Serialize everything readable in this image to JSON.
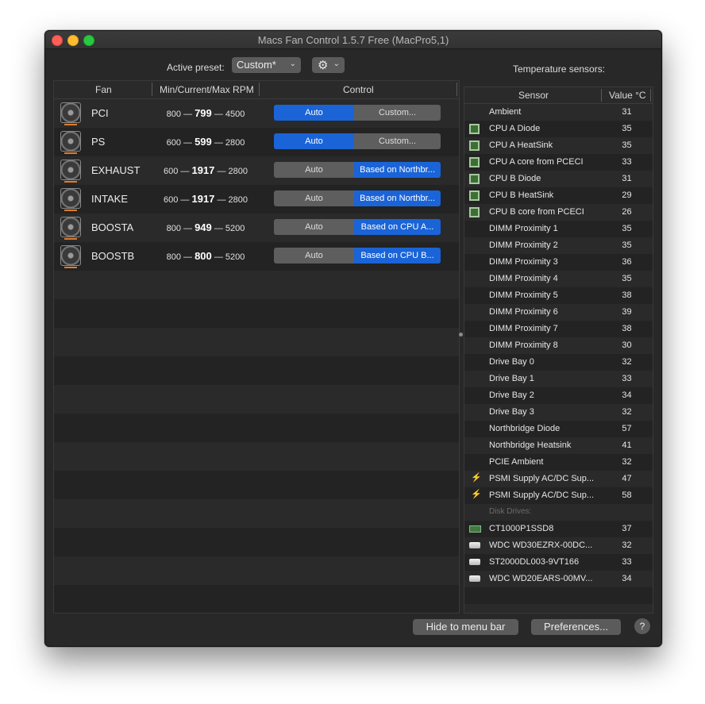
{
  "window": {
    "title": "Macs Fan Control 1.5.7 Free (MacPro5,1)"
  },
  "preset": {
    "label": "Active preset:",
    "value": "Custom*"
  },
  "temperature_label": "Temperature sensors:",
  "fan_table": {
    "headers": {
      "fan": "Fan",
      "rpm": "Min/Current/Max RPM",
      "control": "Control"
    },
    "rows": [
      {
        "name": "PCI",
        "min": "800",
        "current": "799",
        "max": "4500",
        "mode": "Custom",
        "auto_label": "Auto",
        "custom_label": "Custom..."
      },
      {
        "name": "PS",
        "min": "600",
        "current": "599",
        "max": "2800",
        "mode": "Custom",
        "auto_label": "Auto",
        "custom_label": "Custom..."
      },
      {
        "name": "EXHAUST",
        "min": "600",
        "current": "1917",
        "max": "2800",
        "mode": "Sensor",
        "auto_label": "Auto",
        "custom_label": "Based on Northbr..."
      },
      {
        "name": "INTAKE",
        "min": "600",
        "current": "1917",
        "max": "2800",
        "mode": "Sensor",
        "auto_label": "Auto",
        "custom_label": "Based on Northbr..."
      },
      {
        "name": "BOOSTA",
        "min": "800",
        "current": "949",
        "max": "5200",
        "mode": "Sensor",
        "auto_label": "Auto",
        "custom_label": "Based on CPU A..."
      },
      {
        "name": "BOOSTB",
        "min": "800",
        "current": "800",
        "max": "5200",
        "mode": "Sensor",
        "auto_label": "Auto",
        "custom_label": "Based on CPU B..."
      }
    ]
  },
  "sensor_table": {
    "headers": {
      "sensor": "Sensor",
      "value": "Value °C"
    },
    "rows": [
      {
        "name": "Ambient",
        "value": "31",
        "icon": "none"
      },
      {
        "name": "CPU A Diode",
        "value": "35",
        "icon": "chip-icon"
      },
      {
        "name": "CPU A HeatSink",
        "value": "35",
        "icon": "chip-icon"
      },
      {
        "name": "CPU A core from PCECI",
        "value": "33",
        "icon": "chip-icon"
      },
      {
        "name": "CPU B Diode",
        "value": "31",
        "icon": "chip-icon"
      },
      {
        "name": "CPU B HeatSink",
        "value": "29",
        "icon": "chip-icon"
      },
      {
        "name": "CPU B core from PCECI",
        "value": "26",
        "icon": "chip-icon"
      },
      {
        "name": "DIMM Proximity 1",
        "value": "35",
        "icon": "none"
      },
      {
        "name": "DIMM Proximity 2",
        "value": "35",
        "icon": "none"
      },
      {
        "name": "DIMM Proximity 3",
        "value": "36",
        "icon": "none"
      },
      {
        "name": "DIMM Proximity 4",
        "value": "35",
        "icon": "none"
      },
      {
        "name": "DIMM Proximity 5",
        "value": "38",
        "icon": "none"
      },
      {
        "name": "DIMM Proximity 6",
        "value": "39",
        "icon": "none"
      },
      {
        "name": "DIMM Proximity 7",
        "value": "38",
        "icon": "none"
      },
      {
        "name": "DIMM Proximity 8",
        "value": "30",
        "icon": "none"
      },
      {
        "name": "Drive Bay 0",
        "value": "32",
        "icon": "none"
      },
      {
        "name": "Drive Bay 1",
        "value": "33",
        "icon": "none"
      },
      {
        "name": "Drive Bay 2",
        "value": "34",
        "icon": "none"
      },
      {
        "name": "Drive Bay 3",
        "value": "32",
        "icon": "none"
      },
      {
        "name": "Northbridge Diode",
        "value": "57",
        "icon": "none"
      },
      {
        "name": "Northbridge Heatsink",
        "value": "41",
        "icon": "none"
      },
      {
        "name": "PCIE Ambient",
        "value": "32",
        "icon": "none"
      },
      {
        "name": "PSMI Supply AC/DC Sup...",
        "value": "47",
        "icon": "bolt-icon"
      },
      {
        "name": "PSMI Supply AC/DC Sup...",
        "value": "58",
        "icon": "bolt-icon"
      }
    ],
    "disk_label": "Disk Drives:",
    "disks": [
      {
        "name": "CT1000P1SSD8",
        "value": "37",
        "icon": "ssd-icon"
      },
      {
        "name": "WDC WD30EZRX-00DC...",
        "value": "32",
        "icon": "hdd-icon"
      },
      {
        "name": "ST2000DL003-9VT166",
        "value": "33",
        "icon": "hdd-icon"
      },
      {
        "name": "WDC WD20EARS-00MV...",
        "value": "34",
        "icon": "hdd-icon"
      }
    ]
  },
  "buttons": {
    "hide": "Hide to menu bar",
    "preferences": "Preferences...",
    "help": "?"
  }
}
